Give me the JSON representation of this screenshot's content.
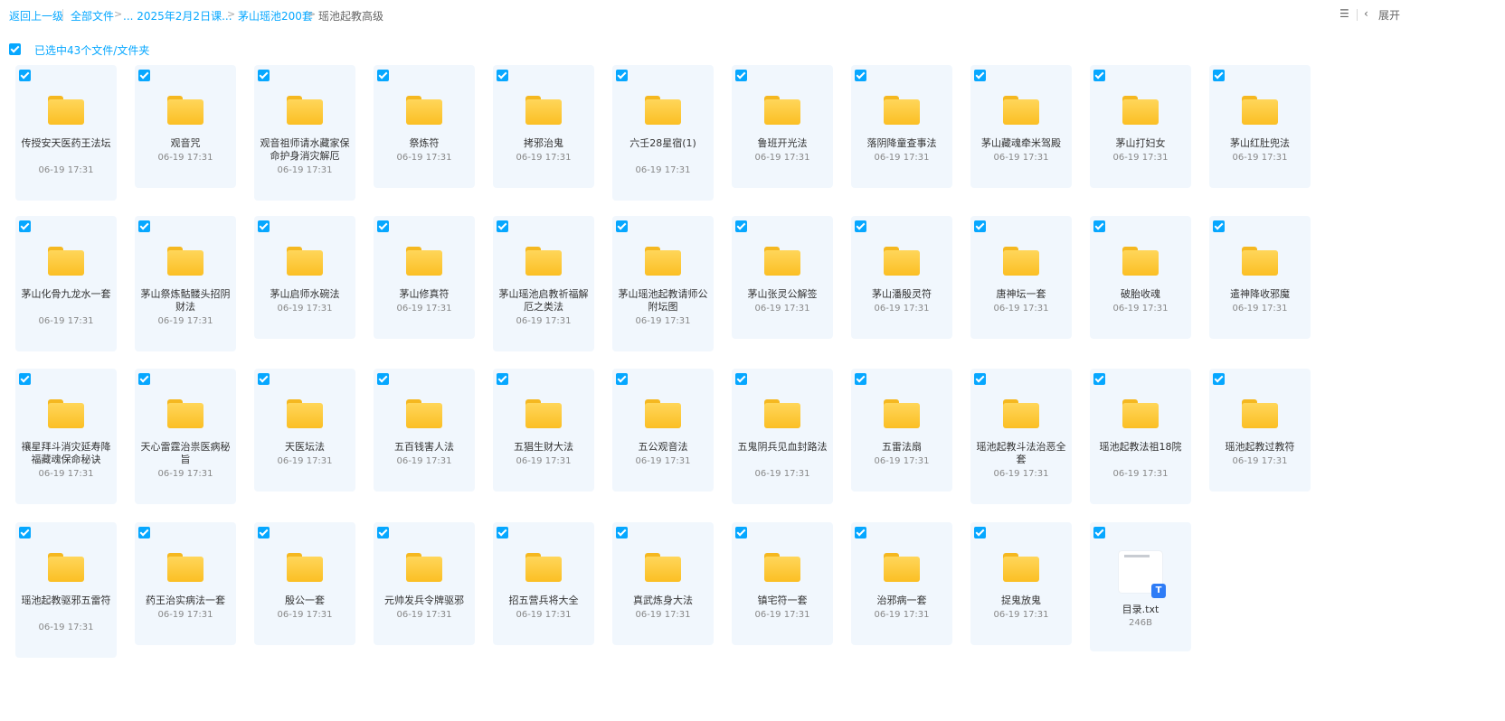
{
  "breadcrumb": {
    "back": "返回上一级",
    "all_files": "全部文件",
    "ellipsis_item": "... 2025年2月2日课...",
    "parent": "茅山瑶池200套",
    "current": "瑶池起教高级"
  },
  "toolbar": {
    "expand_label": "展开"
  },
  "selection": {
    "label": "已选中43个文件/文件夹"
  },
  "items": [
    {
      "name": "传授安天医药王法坛",
      "time": "06-19 17:31"
    },
    {
      "name": "观音咒",
      "time": "06-19 17:31"
    },
    {
      "name": "观音祖师请水藏家保命护身消灾解厄",
      "time": "06-19 17:31"
    },
    {
      "name": "祭炼符",
      "time": "06-19 17:31"
    },
    {
      "name": "拷邪治鬼",
      "time": "06-19 17:31"
    },
    {
      "name": "六壬28星宿(1)",
      "time": "06-19 17:31"
    },
    {
      "name": "鲁班开光法",
      "time": "06-19 17:31"
    },
    {
      "name": "落阴降童查事法",
      "time": "06-19 17:31"
    },
    {
      "name": "茅山藏魂牵米驾殿",
      "time": "06-19 17:31"
    },
    {
      "name": "茅山打妇女",
      "time": "06-19 17:31"
    },
    {
      "name": "茅山红肚兜法",
      "time": "06-19 17:31"
    },
    {
      "name": "茅山化骨九龙水一套",
      "time": "06-19 17:31"
    },
    {
      "name": "茅山祭炼骷髅头招阴财法",
      "time": "06-19 17:31"
    },
    {
      "name": "茅山启师水碗法",
      "time": "06-19 17:31"
    },
    {
      "name": "茅山修真符",
      "time": "06-19 17:31"
    },
    {
      "name": "茅山瑶池启教祈福解厄之类法",
      "time": "06-19 17:31"
    },
    {
      "name": "茅山瑶池起教请师公附坛图",
      "time": "06-19 17:31"
    },
    {
      "name": "茅山张灵公解签",
      "time": "06-19 17:31"
    },
    {
      "name": "茅山潘殷灵符",
      "time": "06-19 17:31"
    },
    {
      "name": "唐神坛一套",
      "time": "06-19 17:31"
    },
    {
      "name": "破胎收魂",
      "time": "06-19 17:31"
    },
    {
      "name": "遣神降收邪魔",
      "time": "06-19 17:31"
    },
    {
      "name": "禳星拜斗消灾延寿降福藏魂保命秘诀",
      "time": "06-19 17:31"
    },
    {
      "name": "天心雷霆治祟医病秘旨",
      "time": "06-19 17:31"
    },
    {
      "name": "天医坛法",
      "time": "06-19 17:31"
    },
    {
      "name": "五百钱害人法",
      "time": "06-19 17:31"
    },
    {
      "name": "五猖生财大法",
      "time": "06-19 17:31"
    },
    {
      "name": "五公观音法",
      "time": "06-19 17:31"
    },
    {
      "name": "五鬼阴兵见血封路法",
      "time": "06-19 17:31"
    },
    {
      "name": "五雷法扇",
      "time": "06-19 17:31"
    },
    {
      "name": "瑶池起教斗法治恶全套",
      "time": "06-19 17:31"
    },
    {
      "name": "瑶池起教法祖18院",
      "time": "06-19 17:31"
    },
    {
      "name": "瑶池起教过教符",
      "time": "06-19 17:31"
    },
    {
      "name": "瑶池起教驱邪五雷符",
      "time": "06-19 17:31"
    },
    {
      "name": "药王治实病法一套",
      "time": "06-19 17:31"
    },
    {
      "name": "殷公一套",
      "time": "06-19 17:31"
    },
    {
      "name": "元帅发兵令牌驱邪",
      "time": "06-19 17:31"
    },
    {
      "name": "招五营兵将大全",
      "time": "06-19 17:31"
    },
    {
      "name": "真武炼身大法",
      "time": "06-19 17:31"
    },
    {
      "name": "镇宅符一套",
      "time": "06-19 17:31"
    },
    {
      "name": "治邪病一套",
      "time": "06-19 17:31"
    },
    {
      "name": "捉鬼放鬼",
      "time": "06-19 17:31"
    },
    {
      "name": "目录.txt",
      "time": "246B",
      "type": "txt"
    }
  ]
}
